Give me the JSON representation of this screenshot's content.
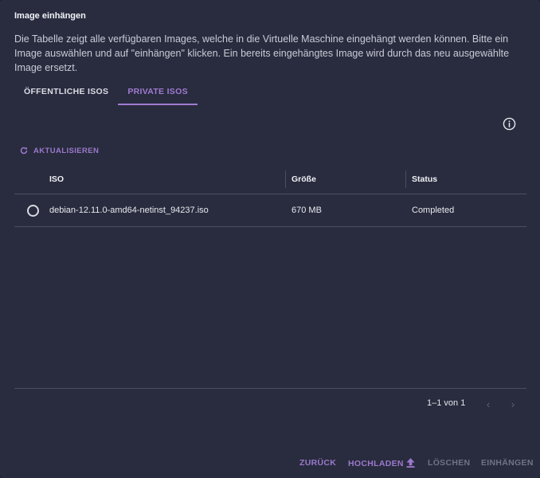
{
  "dialog": {
    "title": "Image einhängen",
    "description": "Die Tabelle zeigt alle verfügbaren Images, welche in die Virtuelle Maschine eingehängt werden können. Bitte ein Image auswählen und auf \"einhängen\" klicken. Ein bereits eingehängtes Image wird durch das neu ausgewählte Image ersetzt."
  },
  "tabs": [
    {
      "label": "ÖFFENTLICHE ISOS",
      "active": false
    },
    {
      "label": "PRIVATE ISOS",
      "active": true
    }
  ],
  "toolbar": {
    "refresh_label": "AKTUALISIEREN",
    "info_icon": "info-icon",
    "refresh_icon": "refresh-icon"
  },
  "table": {
    "headers": {
      "iso": "ISO",
      "size": "Größe",
      "status": "Status"
    },
    "rows": [
      {
        "iso": "debian-12.11.0-amd64-netinst_94237.iso",
        "size": "670 MB",
        "status": "Completed",
        "selected": false
      }
    ]
  },
  "pagination": {
    "range": "1–1 von 1",
    "prev_icon": "chevron-left-icon",
    "next_icon": "chevron-right-icon"
  },
  "actions": {
    "back": "ZURÜCK",
    "upload": "HOCHLADEN",
    "upload_icon": "upload-icon",
    "delete": "LÖSCHEN",
    "mount": "EINHÄNGEN"
  },
  "colors": {
    "accent": "#9c78cc",
    "background": "#282c3e",
    "divider": "#4a4e60",
    "disabled": "#6f7385"
  }
}
